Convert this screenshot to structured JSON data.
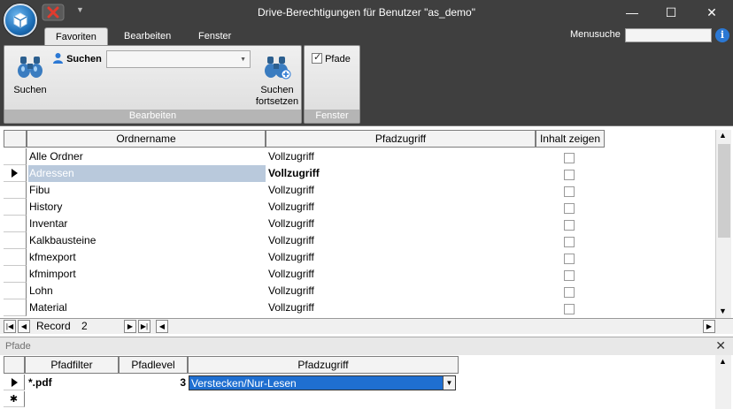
{
  "window": {
    "title": "Drive-Berechtigungen für Benutzer \"as_demo\"",
    "minimize_glyph": "—",
    "maximize_glyph": "☐",
    "close_glyph": "✕"
  },
  "tabs": [
    {
      "label": "Favoriten",
      "active": true
    },
    {
      "label": "Bearbeiten",
      "active": false
    },
    {
      "label": "Fenster",
      "active": false
    }
  ],
  "menusuche": {
    "label": "Menusuche",
    "value": "",
    "info_glyph": "i"
  },
  "ribbon": {
    "group_bearbeiten": {
      "label": "Bearbeiten",
      "search_button": "Suchen",
      "search_inline_label": "Suchen",
      "search_combo_value": "",
      "continue_line1": "Suchen",
      "continue_line2": "fortsetzen"
    },
    "group_fenster": {
      "label": "Fenster",
      "pfade_checkbox": "Pfade",
      "pfade_checked": true
    }
  },
  "main_grid": {
    "columns": [
      "Ordnername",
      "Pfadzugriff",
      "Inhalt zeigen"
    ],
    "rows": [
      {
        "name": "Alle Ordner",
        "access": "Vollzugriff",
        "show": false,
        "current": false,
        "bold": false
      },
      {
        "name": "Adressen",
        "access": "Vollzugriff",
        "show": false,
        "current": true,
        "bold": true
      },
      {
        "name": "Fibu",
        "access": "Vollzugriff",
        "show": false,
        "current": false,
        "bold": false
      },
      {
        "name": "History",
        "access": "Vollzugriff",
        "show": false,
        "current": false,
        "bold": false
      },
      {
        "name": "Inventar",
        "access": "Vollzugriff",
        "show": false,
        "current": false,
        "bold": false
      },
      {
        "name": "Kalkbausteine",
        "access": "Vollzugriff",
        "show": false,
        "current": false,
        "bold": false
      },
      {
        "name": "kfmexport",
        "access": "Vollzugriff",
        "show": false,
        "current": false,
        "bold": false
      },
      {
        "name": "kfmimport",
        "access": "Vollzugriff",
        "show": false,
        "current": false,
        "bold": false
      },
      {
        "name": "Lohn",
        "access": "Vollzugriff",
        "show": false,
        "current": false,
        "bold": false
      },
      {
        "name": "Material",
        "access": "Vollzugriff",
        "show": false,
        "current": false,
        "bold": false
      }
    ],
    "navigator": {
      "label": "Record",
      "current": "2"
    }
  },
  "subform": {
    "title": "Pfade",
    "close_glyph": "✕",
    "columns": [
      "Pfadfilter",
      "Pfadlevel",
      "Pfadzugriff"
    ],
    "row": {
      "filter": "*.pdf",
      "level": "3",
      "access": "Verstecken/Nur-Lesen"
    },
    "new_row_marker": "✱"
  },
  "colors": {
    "chrome": "#3f3f3f",
    "selection": "#1f6fd1",
    "row_highlight": "#b9c9dc",
    "info": "#2b78d4"
  }
}
